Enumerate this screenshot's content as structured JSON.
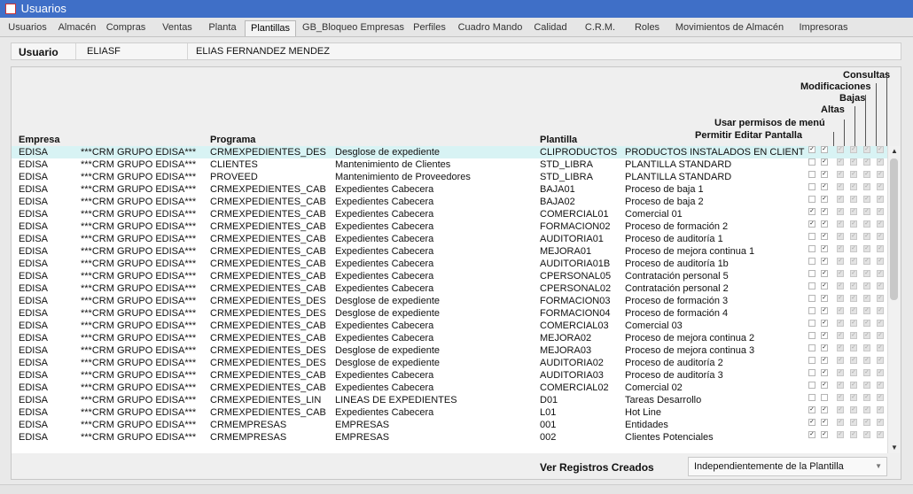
{
  "window": {
    "title": "Usuarios"
  },
  "tabs": [
    {
      "label": "Usuarios"
    },
    {
      "label": "Almacén"
    },
    {
      "label": "Compras"
    },
    {
      "label": "Ventas"
    },
    {
      "label": "Planta"
    },
    {
      "label": "Plantillas"
    },
    {
      "label": "GB_Bloqueo Empresas"
    },
    {
      "label": "Perfiles"
    },
    {
      "label": "Cuadro Mando"
    },
    {
      "label": "Calidad"
    },
    {
      "label": "C.R.M."
    },
    {
      "label": "Roles"
    },
    {
      "label": "Movimientos de Almacén"
    },
    {
      "label": "Impresoras"
    }
  ],
  "active_tab": "Plantillas",
  "user": {
    "label": "Usuario",
    "code": "ELIASF",
    "name": "ELIAS FERNANDEZ MENDEZ"
  },
  "table": {
    "headers": {
      "empresa": "Empresa",
      "programa": "Programa",
      "plantilla": "Plantilla",
      "permitir_editar": "Permitir Editar Pantalla",
      "usar_permisos": "Usar permisos de menú",
      "altas": "Altas",
      "bajas": "Bajas",
      "modificaciones": "Modificaciones",
      "consultas": "Consultas"
    },
    "rows": [
      {
        "empresa": "EDISA",
        "empresa_desc": "***CRM GRUPO EDISA***",
        "programa": "CRMEXPEDIENTES_DES",
        "programa_desc": "Desglose de expediente",
        "plantilla": "CLIPRODUCTOS",
        "plantilla_desc": "PRODUCTOS INSTALADOS EN CLIENT",
        "editar": true,
        "permisos": true,
        "altas": true,
        "bajas": true,
        "modif": true,
        "consultas": true
      },
      {
        "empresa": "EDISA",
        "empresa_desc": "***CRM GRUPO EDISA***",
        "programa": "CLIENTES",
        "programa_desc": "Mantenimiento de Clientes",
        "plantilla": "STD_LIBRA",
        "plantilla_desc": "PLANTILLA STANDARD",
        "editar": false,
        "permisos": true,
        "altas": true,
        "bajas": true,
        "modif": true,
        "consultas": true
      },
      {
        "empresa": "EDISA",
        "empresa_desc": "***CRM GRUPO EDISA***",
        "programa": "PROVEED",
        "programa_desc": "Mantenimiento de Proveedores",
        "plantilla": "STD_LIBRA",
        "plantilla_desc": "PLANTILLA STANDARD",
        "editar": false,
        "permisos": true,
        "altas": true,
        "bajas": true,
        "modif": true,
        "consultas": true
      },
      {
        "empresa": "EDISA",
        "empresa_desc": "***CRM GRUPO EDISA***",
        "programa": "CRMEXPEDIENTES_CAB",
        "programa_desc": "Expedientes Cabecera",
        "plantilla": "BAJA01",
        "plantilla_desc": "Proceso de baja 1",
        "editar": false,
        "permisos": true,
        "altas": true,
        "bajas": true,
        "modif": true,
        "consultas": true
      },
      {
        "empresa": "EDISA",
        "empresa_desc": "***CRM GRUPO EDISA***",
        "programa": "CRMEXPEDIENTES_CAB",
        "programa_desc": "Expedientes Cabecera",
        "plantilla": "BAJA02",
        "plantilla_desc": "Proceso de baja 2",
        "editar": false,
        "permisos": true,
        "altas": true,
        "bajas": true,
        "modif": true,
        "consultas": true
      },
      {
        "empresa": "EDISA",
        "empresa_desc": "***CRM GRUPO EDISA***",
        "programa": "CRMEXPEDIENTES_CAB",
        "programa_desc": "Expedientes Cabecera",
        "plantilla": "COMERCIAL01",
        "plantilla_desc": "Comercial 01",
        "editar": true,
        "permisos": true,
        "altas": true,
        "bajas": true,
        "modif": true,
        "consultas": true
      },
      {
        "empresa": "EDISA",
        "empresa_desc": "***CRM GRUPO EDISA***",
        "programa": "CRMEXPEDIENTES_CAB",
        "programa_desc": "Expedientes Cabecera",
        "plantilla": "FORMACION02",
        "plantilla_desc": "Proceso de formación 2",
        "editar": true,
        "permisos": true,
        "altas": true,
        "bajas": true,
        "modif": true,
        "consultas": true
      },
      {
        "empresa": "EDISA",
        "empresa_desc": "***CRM GRUPO EDISA***",
        "programa": "CRMEXPEDIENTES_CAB",
        "programa_desc": "Expedientes Cabecera",
        "plantilla": "AUDITORIA01",
        "plantilla_desc": "Proceso de auditoría 1",
        "editar": false,
        "permisos": true,
        "altas": true,
        "bajas": true,
        "modif": true,
        "consultas": true
      },
      {
        "empresa": "EDISA",
        "empresa_desc": "***CRM GRUPO EDISA***",
        "programa": "CRMEXPEDIENTES_CAB",
        "programa_desc": "Expedientes Cabecera",
        "plantilla": "MEJORA01",
        "plantilla_desc": "Proceso de mejora continua 1",
        "editar": false,
        "permisos": true,
        "altas": true,
        "bajas": true,
        "modif": true,
        "consultas": true
      },
      {
        "empresa": "EDISA",
        "empresa_desc": "***CRM GRUPO EDISA***",
        "programa": "CRMEXPEDIENTES_CAB",
        "programa_desc": "Expedientes Cabecera",
        "plantilla": "AUDITORIA01B",
        "plantilla_desc": "Proceso de auditoría 1b",
        "editar": false,
        "permisos": true,
        "altas": true,
        "bajas": true,
        "modif": true,
        "consultas": true
      },
      {
        "empresa": "EDISA",
        "empresa_desc": "***CRM GRUPO EDISA***",
        "programa": "CRMEXPEDIENTES_CAB",
        "programa_desc": "Expedientes Cabecera",
        "plantilla": "CPERSONAL05",
        "plantilla_desc": "Contratación personal 5",
        "editar": false,
        "permisos": true,
        "altas": true,
        "bajas": true,
        "modif": true,
        "consultas": true
      },
      {
        "empresa": "EDISA",
        "empresa_desc": "***CRM GRUPO EDISA***",
        "programa": "CRMEXPEDIENTES_CAB",
        "programa_desc": "Expedientes Cabecera",
        "plantilla": "CPERSONAL02",
        "plantilla_desc": "Contratación personal 2",
        "editar": false,
        "permisos": true,
        "altas": true,
        "bajas": true,
        "modif": true,
        "consultas": true
      },
      {
        "empresa": "EDISA",
        "empresa_desc": "***CRM GRUPO EDISA***",
        "programa": "CRMEXPEDIENTES_DES",
        "programa_desc": "Desglose de expediente",
        "plantilla": "FORMACION03",
        "plantilla_desc": "Proceso de formación 3",
        "editar": false,
        "permisos": true,
        "altas": true,
        "bajas": true,
        "modif": true,
        "consultas": true
      },
      {
        "empresa": "EDISA",
        "empresa_desc": "***CRM GRUPO EDISA***",
        "programa": "CRMEXPEDIENTES_DES",
        "programa_desc": "Desglose de expediente",
        "plantilla": "FORMACION04",
        "plantilla_desc": "Proceso de formación 4",
        "editar": false,
        "permisos": true,
        "altas": true,
        "bajas": true,
        "modif": true,
        "consultas": true
      },
      {
        "empresa": "EDISA",
        "empresa_desc": "***CRM GRUPO EDISA***",
        "programa": "CRMEXPEDIENTES_CAB",
        "programa_desc": "Expedientes Cabecera",
        "plantilla": "COMERCIAL03",
        "plantilla_desc": "Comercial 03",
        "editar": false,
        "permisos": true,
        "altas": true,
        "bajas": true,
        "modif": true,
        "consultas": true
      },
      {
        "empresa": "EDISA",
        "empresa_desc": "***CRM GRUPO EDISA***",
        "programa": "CRMEXPEDIENTES_CAB",
        "programa_desc": "Expedientes Cabecera",
        "plantilla": "MEJORA02",
        "plantilla_desc": "Proceso de mejora continua 2",
        "editar": false,
        "permisos": true,
        "altas": true,
        "bajas": true,
        "modif": true,
        "consultas": true
      },
      {
        "empresa": "EDISA",
        "empresa_desc": "***CRM GRUPO EDISA***",
        "programa": "CRMEXPEDIENTES_DES",
        "programa_desc": "Desglose de expediente",
        "plantilla": "MEJORA03",
        "plantilla_desc": "Proceso de mejora continua 3",
        "editar": false,
        "permisos": true,
        "altas": true,
        "bajas": true,
        "modif": true,
        "consultas": true
      },
      {
        "empresa": "EDISA",
        "empresa_desc": "***CRM GRUPO EDISA***",
        "programa": "CRMEXPEDIENTES_DES",
        "programa_desc": "Desglose de expediente",
        "plantilla": "AUDITORIA02",
        "plantilla_desc": "Proceso de auditoría 2",
        "editar": false,
        "permisos": true,
        "altas": true,
        "bajas": true,
        "modif": true,
        "consultas": true
      },
      {
        "empresa": "EDISA",
        "empresa_desc": "***CRM GRUPO EDISA***",
        "programa": "CRMEXPEDIENTES_CAB",
        "programa_desc": "Expedientes Cabecera",
        "plantilla": "AUDITORIA03",
        "plantilla_desc": "Proceso de auditoría 3",
        "editar": false,
        "permisos": true,
        "altas": true,
        "bajas": true,
        "modif": true,
        "consultas": true
      },
      {
        "empresa": "EDISA",
        "empresa_desc": "***CRM GRUPO EDISA***",
        "programa": "CRMEXPEDIENTES_CAB",
        "programa_desc": "Expedientes Cabecera",
        "plantilla": "COMERCIAL02",
        "plantilla_desc": "Comercial 02",
        "editar": false,
        "permisos": true,
        "altas": true,
        "bajas": true,
        "modif": true,
        "consultas": true
      },
      {
        "empresa": "EDISA",
        "empresa_desc": "***CRM GRUPO EDISA***",
        "programa": "CRMEXPEDIENTES_LIN",
        "programa_desc": "LINEAS DE EXPEDIENTES",
        "plantilla": "D01",
        "plantilla_desc": "Tareas Desarrollo",
        "editar": false,
        "permisos": false,
        "altas": true,
        "bajas": true,
        "modif": true,
        "consultas": true
      },
      {
        "empresa": "EDISA",
        "empresa_desc": "***CRM GRUPO EDISA***",
        "programa": "CRMEXPEDIENTES_CAB",
        "programa_desc": "Expedientes Cabecera",
        "plantilla": "L01",
        "plantilla_desc": "Hot Line",
        "editar": true,
        "permisos": true,
        "altas": true,
        "bajas": true,
        "modif": true,
        "consultas": true
      },
      {
        "empresa": "EDISA",
        "empresa_desc": "***CRM GRUPO EDISA***",
        "programa": "CRMEMPRESAS",
        "programa_desc": "EMPRESAS",
        "plantilla": "001",
        "plantilla_desc": "Entidades",
        "editar": true,
        "permisos": true,
        "altas": true,
        "bajas": true,
        "modif": true,
        "consultas": true
      },
      {
        "empresa": "EDISA",
        "empresa_desc": "***CRM GRUPO EDISA***",
        "programa": "CRMEMPRESAS",
        "programa_desc": "EMPRESAS",
        "plantilla": "002",
        "plantilla_desc": "Clientes Potenciales",
        "editar": true,
        "permisos": true,
        "altas": true,
        "bajas": true,
        "modif": true,
        "consultas": true
      }
    ]
  },
  "footer": {
    "ver_registros_label": "Ver Registros Creados",
    "ver_registros_value": "Independientemente de la Plantilla"
  },
  "colors": {
    "titlebar": "#3f6fc7",
    "selected_row": "#d8f3f4"
  }
}
